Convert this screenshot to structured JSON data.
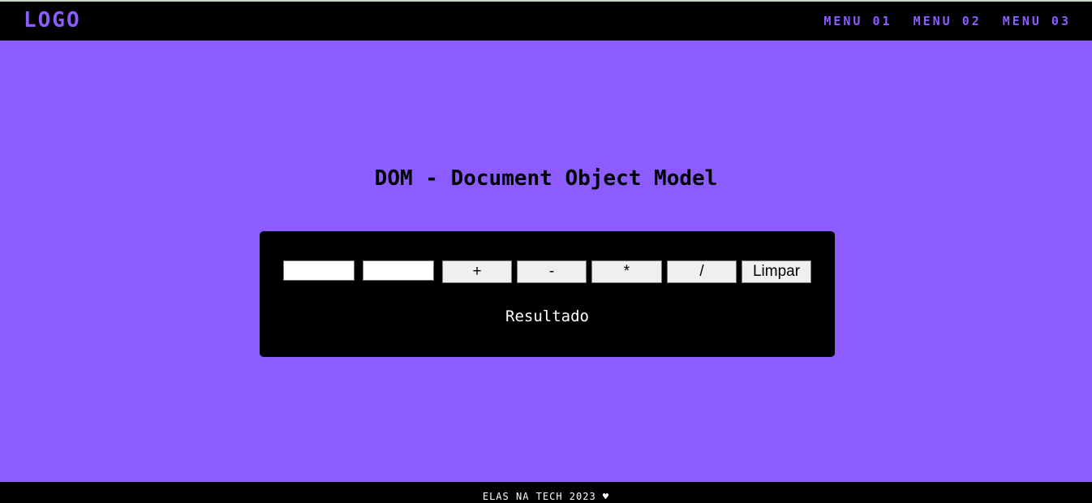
{
  "header": {
    "logo": "LOGO",
    "menu": [
      "MENU 01",
      "MENU 02",
      "MENU 03"
    ]
  },
  "main": {
    "title": "DOM - Document Object Model",
    "calculator": {
      "input1_value": "",
      "input2_value": "",
      "buttons": {
        "add": "+",
        "subtract": "-",
        "multiply": "*",
        "divide": "/",
        "clear": "Limpar"
      },
      "result": "Resultado"
    }
  },
  "footer": {
    "text": "ELAS NA TECH 2023 ♥"
  },
  "colors": {
    "background": "#8c5cff",
    "bars": "#000000",
    "accent": "#8c5cff"
  }
}
